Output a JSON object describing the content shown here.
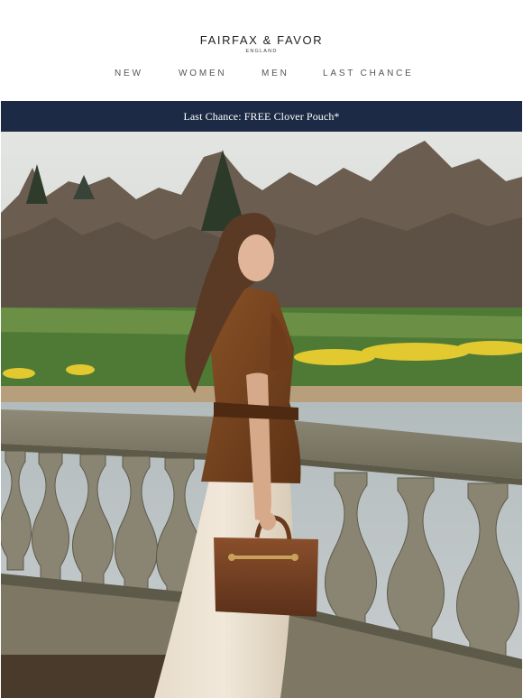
{
  "brand": {
    "name": "FAIRFAX & FAVOR",
    "sub": "ENGLAND"
  },
  "nav": {
    "items": [
      {
        "label": "NEW"
      },
      {
        "label": "WOMEN"
      },
      {
        "label": "MEN"
      },
      {
        "label": "LAST CHANCE"
      }
    ]
  },
  "banner": {
    "text": "Last Chance: FREE Clover Pouch*",
    "background": "#1c2a45",
    "text_color": "#ffffff"
  },
  "hero": {
    "alt": "Woman in brown suede jacket and cream skirt holding a tan leather handbag on a stone balustrade by a lake"
  }
}
